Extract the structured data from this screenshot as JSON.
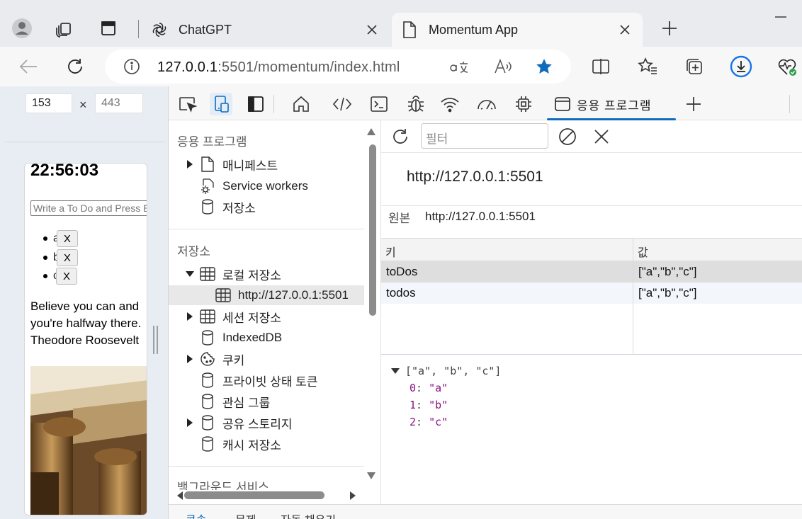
{
  "browser": {
    "tabs": [
      {
        "title": "ChatGPT",
        "active": false
      },
      {
        "title": "Momentum App",
        "active": true
      }
    ],
    "address": {
      "host": "127.0.0.1",
      "rest": ":5501/momentum/index.html"
    },
    "colors": {
      "accent": "#0f6cbd",
      "download_ring": "#1a73e8"
    }
  },
  "viewport": {
    "width_value": "153",
    "height_value": "443",
    "separator": "×",
    "page": {
      "clock": "22:56:03",
      "todo_placeholder": "Write a To Do and Press Enter",
      "todos": [
        {
          "text": "a",
          "button": "X"
        },
        {
          "text": "b",
          "button": "X"
        },
        {
          "text": "c",
          "button": "X"
        }
      ],
      "quote": "Believe you can and you're halfway there. Theodore Roosevelt"
    }
  },
  "devtools": {
    "active_tab_label": "응용 프로그램",
    "sidebar": {
      "app_section": "응용 프로그램",
      "app_items": [
        "매니페스트",
        "Service workers",
        "저장소"
      ],
      "storage_section": "저장소",
      "local_storage": "로컬 저장소",
      "local_origin": "http://127.0.0.1:5501",
      "storage_items": [
        "세션 저장소",
        "IndexedDB",
        "쿠키",
        "프라이빗 상태 토큰",
        "관심 그룹",
        "공유 스토리지",
        "캐시 저장소"
      ],
      "background_section": "백그라운드 서비스"
    },
    "main": {
      "filter_placeholder": "필터",
      "origin_title": "http://127.0.0.1:5501",
      "origin_label": "원본",
      "origin_value": "http://127.0.0.1:5501",
      "columns": [
        "키",
        "값"
      ],
      "rows": [
        {
          "key": "toDos",
          "value": "[\"a\",\"b\",\"c\"]"
        },
        {
          "key": "todos",
          "value": "[\"a\",\"b\",\"c\"]"
        }
      ],
      "json_preview": {
        "summary": "[\"a\", \"b\", \"c\"]",
        "entries": [
          {
            "index": "0",
            "value": "\"a\""
          },
          {
            "index": "1",
            "value": "\"b\""
          },
          {
            "index": "2",
            "value": "\"c\""
          }
        ]
      }
    },
    "drawer_tabs": [
      "콘솔",
      "문제",
      "자동 채우기"
    ]
  }
}
